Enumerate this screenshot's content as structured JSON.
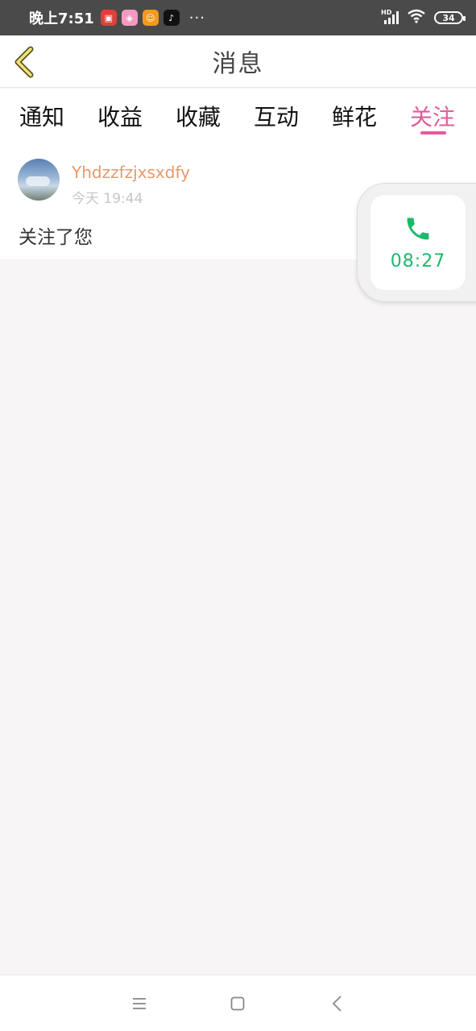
{
  "status_bar": {
    "time": "晚上7:51",
    "more": "···",
    "battery": "34",
    "network_label": "HD"
  },
  "header": {
    "title": "消息",
    "back_icon": "chevron-left-icon"
  },
  "tabs": [
    {
      "label": "通知",
      "active": false
    },
    {
      "label": "收益",
      "active": false
    },
    {
      "label": "收藏",
      "active": false
    },
    {
      "label": "互动",
      "active": false
    },
    {
      "label": "鲜花",
      "active": false
    },
    {
      "label": "关注",
      "active": true
    }
  ],
  "messages": [
    {
      "username": "Yhdzzfzjxsxdfy",
      "time": "今天 19:44",
      "text": "关注了您"
    }
  ],
  "call_widget": {
    "icon": "phone-icon",
    "duration": "08:27"
  },
  "colors": {
    "accent": "#e35c9a",
    "username": "#e69a6a",
    "call_green": "#1fb86a"
  }
}
